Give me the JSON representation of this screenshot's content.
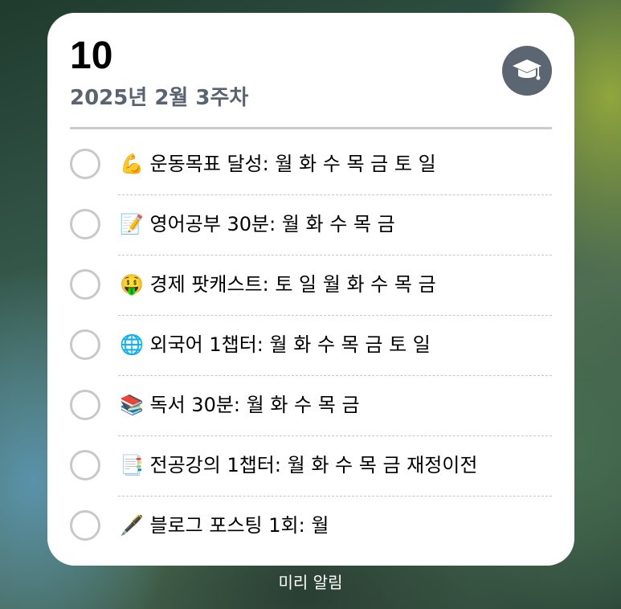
{
  "widget": {
    "count": "10",
    "subtitle": "2025년 2월 3주차",
    "list_icon": "graduation-cap-icon",
    "accent_color": "#5b6672",
    "items": [
      {
        "label": "💪 운동목표 달성: 월 화 수 목 금 토 일",
        "completed": false
      },
      {
        "label": "📝 영어공부 30분: 월 화 수 목 금",
        "completed": false
      },
      {
        "label": "🤑 경제 팟캐스트: 토 일 월 화 수 목 금",
        "completed": false
      },
      {
        "label": "🌐 외국어 1챕터: 월 화 수 목 금 토 일",
        "completed": false
      },
      {
        "label": "📚 독서 30분: 월 화 수 목 금",
        "completed": false
      },
      {
        "label": "📑 전공강의 1챕터: 월 화 수 목 금 재정이전",
        "completed": false
      },
      {
        "label": "🖋️ 블로그 포스팅 1회: 월",
        "completed": false
      }
    ]
  },
  "footer": {
    "label": "미리 알림"
  }
}
